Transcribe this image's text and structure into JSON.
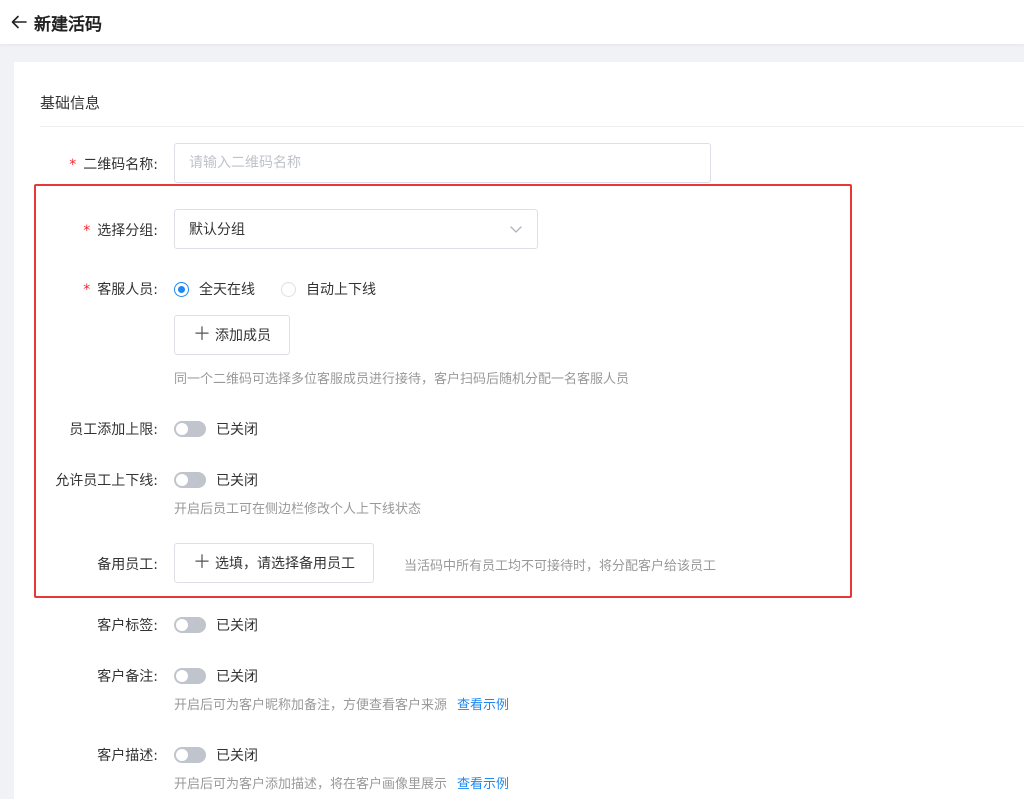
{
  "header": {
    "back_icon": "arrow-left-icon",
    "title": "新建活码"
  },
  "section": {
    "title": "基础信息"
  },
  "form": {
    "qr_name": {
      "label": "二维码名称:",
      "placeholder": "请输入二维码名称",
      "value": ""
    },
    "group": {
      "label": "选择分组:",
      "value": "默认分组",
      "icon": "chevron-down-icon"
    },
    "staff": {
      "label": "客服人员:",
      "options": [
        {
          "label": "全天在线",
          "checked": true
        },
        {
          "label": "自动上下线",
          "checked": false
        }
      ],
      "add_button": "添加成员",
      "hint": "同一个二维码可选择多位客服成员进行接待，客户扫码后随机分配一名客服人员"
    },
    "add_limit": {
      "label": "员工添加上限:",
      "status": "已关闭"
    },
    "allow_online": {
      "label": "允许员工上下线:",
      "status": "已关闭",
      "hint": "开启后员工可在侧边栏修改个人上下线状态"
    },
    "backup": {
      "label": "备用员工:",
      "button": "选填，请选择备用员工",
      "hint": "当活码中所有员工均不可接待时，将分配客户给该员工"
    },
    "customer_tag": {
      "label": "客户标签:",
      "status": "已关闭"
    },
    "customer_note": {
      "label": "客户备注:",
      "status": "已关闭",
      "hint": "开启后可为客户昵称加备注，方便查看客户来源",
      "link": "查看示例"
    },
    "customer_desc": {
      "label": "客户描述:",
      "status": "已关闭",
      "hint": "开启后可为客户添加描述，将在客户画像里展示",
      "link": "查看示例"
    }
  },
  "colors": {
    "accent": "#1e87f0",
    "required": "#f5222d",
    "highlight": "#e53935",
    "switch_off": "#c0c4cc"
  }
}
